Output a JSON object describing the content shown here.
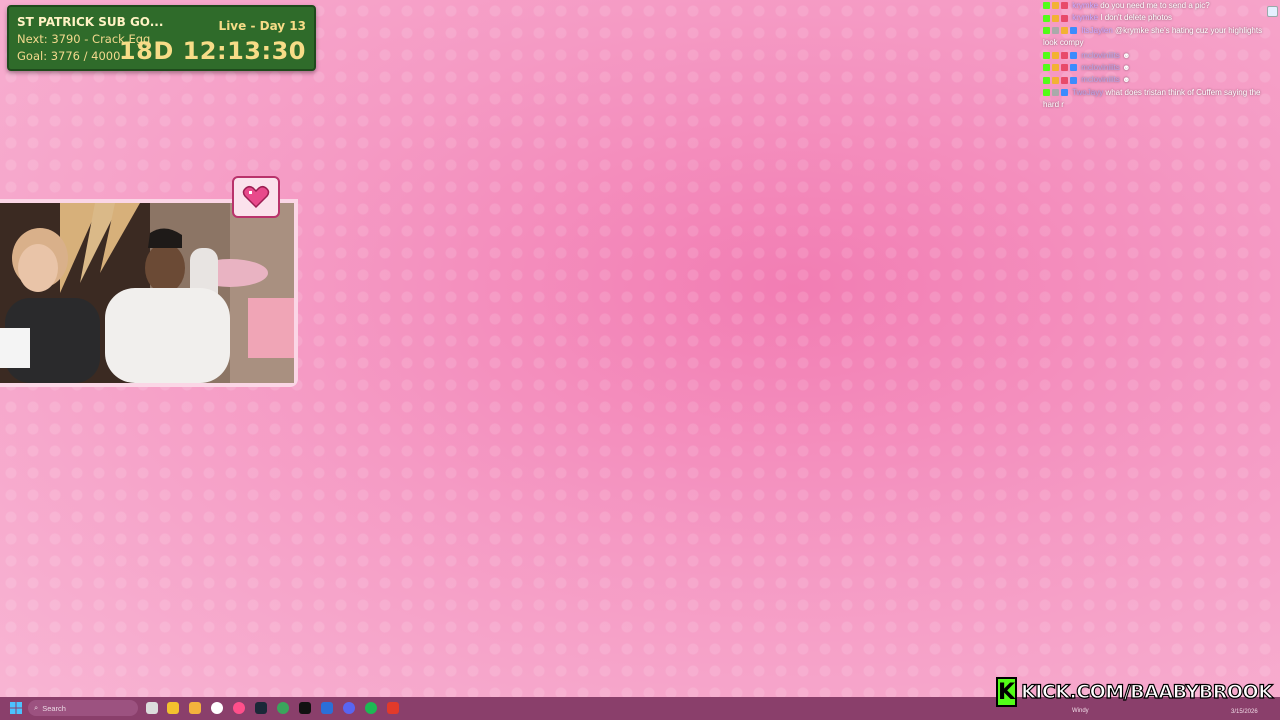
{
  "sub_goal": {
    "title": "ST PATRICK SUB GO...",
    "next": "Next: 3790 - Crack Egg",
    "goal": "Goal: 3776 / 4000",
    "live": "Live - Day 13",
    "timer": "18D  12:13:30"
  },
  "chat": {
    "messages": [
      {
        "user": "krymke",
        "text": "do you need me to send a pic?"
      },
      {
        "user": "krymke",
        "text": "I don't delete photos"
      },
      {
        "user": "ItsJaylen",
        "text": "@krymke she's hating cuz your highlights look compy"
      },
      {
        "user": "mcloviniiits",
        "text": ""
      },
      {
        "user": "mcloviniiits",
        "text": ""
      },
      {
        "user": "mcloviniiits",
        "text": ""
      },
      {
        "user": "TwoJayy",
        "text": "what does tristan think of Cuffem saying the hard r"
      }
    ]
  },
  "taskbar": {
    "search_placeholder": "Search",
    "weather": "Windy",
    "date": "3/15/2026"
  },
  "kick": {
    "logo_letter": "K",
    "url": "KICK.COM/BAABYBROOK"
  },
  "colors": {
    "goal_bg": "#2f6b2a",
    "goal_text": "#f7dc87",
    "kick_green": "#53fc18",
    "taskbar": "#8a3f6b"
  }
}
